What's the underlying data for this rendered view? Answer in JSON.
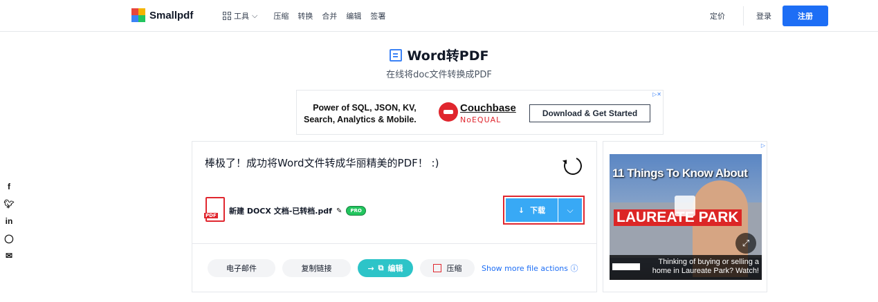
{
  "header": {
    "logo": "Smallpdf",
    "nav": {
      "tools": "工具",
      "items": [
        "压缩",
        "转换",
        "合并",
        "编辑",
        "签署"
      ]
    },
    "pricing": "定价",
    "login": "登录",
    "signup": "注册"
  },
  "page": {
    "title": "Word转PDF",
    "subtitle": "在线将doc文件转换成PDF"
  },
  "ad_top": {
    "line1": "Power of SQL, JSON, KV,",
    "line2": "Search, Analytics & Mobile.",
    "brand": "Couchbase",
    "tagline": "NoEQUAL",
    "cta": "Download & Get Started"
  },
  "result": {
    "message": "棒极了！成功将Word文件转成华丽精美的PDF！ :)",
    "file_name": "新建 DOCX 文档-已转档.pdf",
    "pro_badge": "PRO",
    "download": "下载",
    "actions": {
      "email": "电子邮件",
      "copy_link": "复制链接",
      "edit": "编辑",
      "compress": "压缩",
      "more": "Show more file actions"
    }
  },
  "ad_side": {
    "headline": "11 Things To Know About",
    "place": "LAUREATE PARK",
    "caption1": "Thinking of buying or selling a",
    "caption2": "home in Laureate Park? Watch!"
  },
  "social": [
    "f",
    "t",
    "in",
    "w",
    "m"
  ]
}
